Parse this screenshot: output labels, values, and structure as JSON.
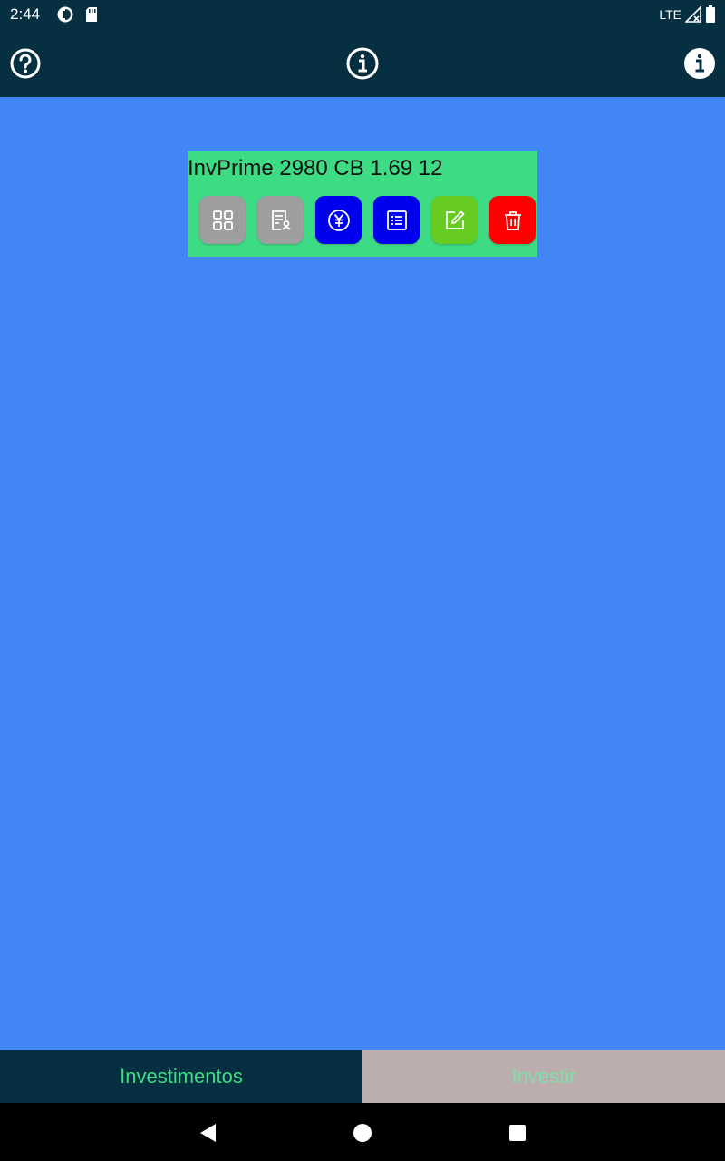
{
  "status_bar": {
    "time": "2:44",
    "network": "LTE",
    "icons": [
      "app-notification-icon",
      "sd-card-icon",
      "signal-icon",
      "battery-icon"
    ]
  },
  "app_bar": {
    "left_icon": "help-icon",
    "center_icon": "info-icon",
    "right_icon": "info-filled-icon"
  },
  "investment_card": {
    "title": "InvPrime 2980 CB 1.69 12",
    "background": "#3ddc84",
    "actions": [
      {
        "icon": "grid-icon",
        "color": "#9e9e9e"
      },
      {
        "icon": "document-user-icon",
        "color": "#9e9e9e"
      },
      {
        "icon": "yen-icon",
        "color": "#0000ee"
      },
      {
        "icon": "list-icon",
        "color": "#0000ee"
      },
      {
        "icon": "edit-icon",
        "color": "#66cc22"
      },
      {
        "icon": "trash-icon",
        "color": "#ff0000"
      }
    ]
  },
  "bottom_nav": {
    "tabs": [
      {
        "label": "Investimentos",
        "active": true,
        "background": "#063042",
        "color": "#3ddc84"
      },
      {
        "label": "Investir",
        "active": false,
        "background": "#bcaeae",
        "color": "#7de0a8"
      }
    ]
  },
  "system_nav": {
    "buttons": [
      "back-icon",
      "home-icon",
      "recents-icon"
    ]
  },
  "colors": {
    "app_bar": "#063042",
    "content_background": "#4285f4"
  }
}
